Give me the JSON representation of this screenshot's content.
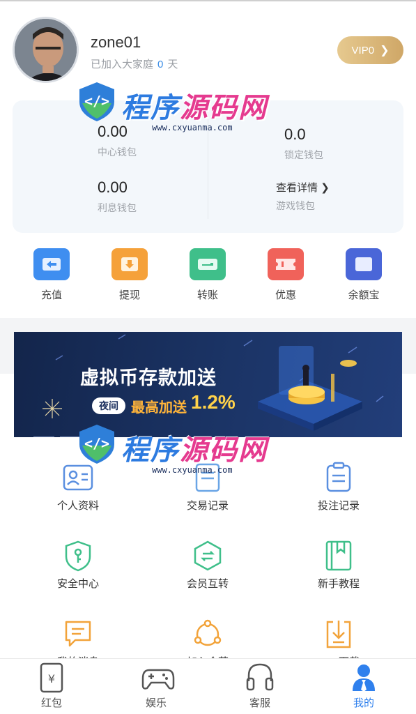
{
  "profile": {
    "username": "zone01",
    "joined_prefix": "已加入大家庭",
    "joined_days": "0",
    "joined_suffix": "天",
    "vip_label": "VIP0"
  },
  "wallet": {
    "center": {
      "value": "0.00",
      "label": "中心钱包"
    },
    "locked": {
      "value": "0.0",
      "label": "锁定钱包"
    },
    "interest": {
      "value": "0.00",
      "label": "利息钱包"
    },
    "game": {
      "link": "查看详情",
      "label": "游戏钱包"
    }
  },
  "actions": [
    {
      "label": "充值",
      "icon": "deposit-icon",
      "color": "#3f8ef0"
    },
    {
      "label": "提现",
      "icon": "withdraw-icon",
      "color": "#f5a13a"
    },
    {
      "label": "转账",
      "icon": "transfer-icon",
      "color": "#3fbf8a"
    },
    {
      "label": "优惠",
      "icon": "coupon-icon",
      "color": "#f0625a"
    },
    {
      "label": "余额宝",
      "icon": "savings-icon",
      "color": "#4a66d8"
    }
  ],
  "banner": {
    "title": "虚拟币存款加送",
    "badge": "夜间",
    "promo": "最高加送",
    "percent": "1.2%"
  },
  "menu": [
    {
      "label": "个人资料",
      "icon": "profile-card-icon"
    },
    {
      "label": "交易记录",
      "icon": "transactions-icon"
    },
    {
      "label": "投注记录",
      "icon": "bet-record-icon"
    },
    {
      "label": "安全中心",
      "icon": "security-shield-icon"
    },
    {
      "label": "会员互转",
      "icon": "member-transfer-icon"
    },
    {
      "label": "新手教程",
      "icon": "tutorial-book-icon"
    },
    {
      "label": "我的消息",
      "icon": "message-icon"
    },
    {
      "label": "加入合营",
      "icon": "partner-icon"
    },
    {
      "label": "APP下载",
      "icon": "download-icon"
    }
  ],
  "tabs": [
    {
      "label": "红包",
      "icon": "red-envelope-icon"
    },
    {
      "label": "娱乐",
      "icon": "gamepad-icon"
    },
    {
      "label": "客服",
      "icon": "headset-icon"
    },
    {
      "label": "我的",
      "icon": "user-icon",
      "active": true
    }
  ],
  "watermark": {
    "part1": "程序",
    "part2": "源码网",
    "url": "www.cxyuanma.com"
  },
  "colors": {
    "accent": "#2f80ed",
    "vip_gold": "#d9b577",
    "wallet_bg": "#f3f7fb"
  }
}
